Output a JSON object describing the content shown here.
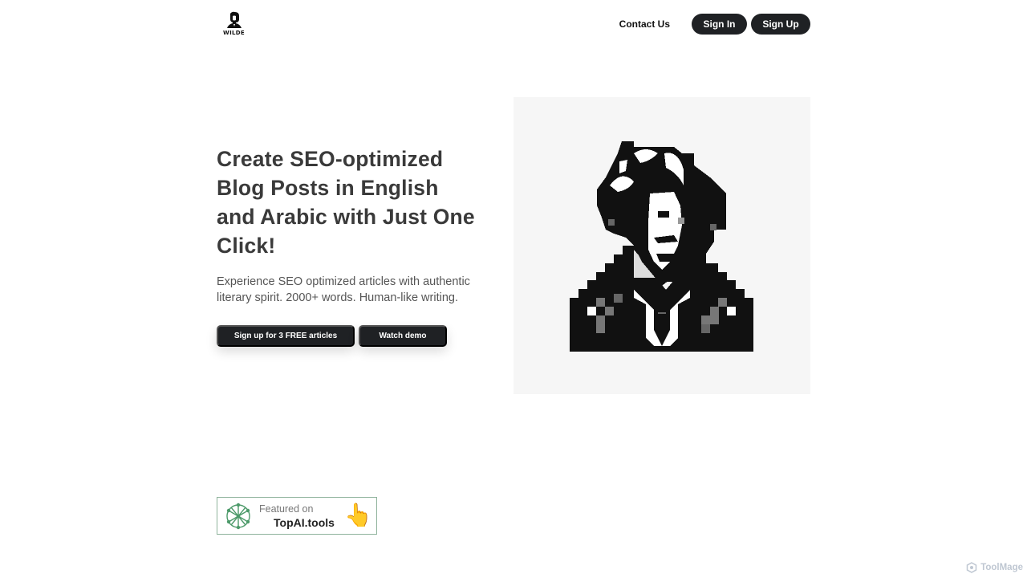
{
  "header": {
    "logo_text": "WILDE",
    "nav": {
      "contact": "Contact Us",
      "sign_in": "Sign In",
      "sign_up": "Sign Up"
    }
  },
  "hero": {
    "title": "Create SEO-optimized Blog Posts in English and Arabic with Just One Click!",
    "subtitle": "Experience SEO optimized articles with authentic literary spirit. 2000+ words. Human-like writing.",
    "cta_primary": "Sign up for 3 FREE articles",
    "cta_demo": "Watch demo"
  },
  "featured": {
    "label": "Featured on",
    "name": "TopAI.tools"
  },
  "watermark": {
    "text": "ToolMage"
  },
  "colors": {
    "button_bg": "#1f2124",
    "button_text": "#ffffff",
    "heading": "#3a3a3a",
    "badge_border": "#8fb39c",
    "badge_logo": "#4d9a6a"
  },
  "icons": {
    "logo": "wilde-portrait-icon",
    "portrait": "pixel-art-portrait",
    "badge_logo": "topai-network-icon",
    "badge_hand": "pointing-hand-icon",
    "watermark": "toolmage-icon"
  }
}
